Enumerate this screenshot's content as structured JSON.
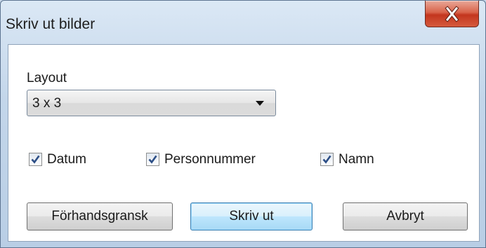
{
  "window": {
    "title": "Skriv ut bilder"
  },
  "layout": {
    "label": "Layout",
    "selected": "3 x 3"
  },
  "options": [
    {
      "label": "Datum",
      "checked": true
    },
    {
      "label": "Personnummer",
      "checked": true
    },
    {
      "label": "Namn",
      "checked": true
    }
  ],
  "buttons": {
    "preview": "Förhandsgransk",
    "print": "Skriv ut",
    "cancel": "Avbryt"
  },
  "colors": {
    "checkmark": "#2c4e86",
    "close_button": "#c3361e",
    "default_button_border": "#3c7fb1"
  },
  "icons": {
    "close": "close-icon",
    "dropdown": "chevron-down-icon",
    "check": "checkmark-icon"
  }
}
